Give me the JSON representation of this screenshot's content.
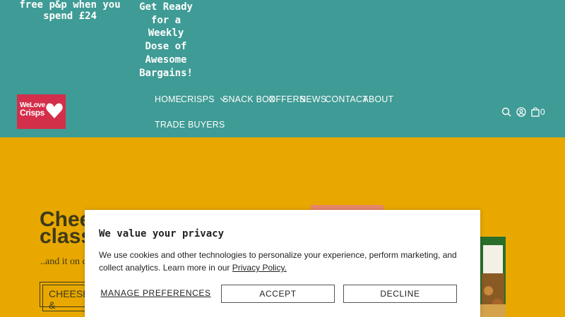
{
  "promo": {
    "delivery": "free p&p when you spend £24",
    "weekly": "Get Ready for a Weekly Dose of Awesome Bargains!"
  },
  "logo": {
    "line1": "WeLove",
    "line2": "Crisps"
  },
  "nav": {
    "home": "HOME",
    "crisps": "CRISPS",
    "snack_box": "SNACK BOX",
    "offers": "OFFERS",
    "news": "NEWS",
    "contact": "CONTACT",
    "about": "ABOUT",
    "trade_buyers": "TRADE BUYERS"
  },
  "header_icons": {
    "search": "search-icon",
    "account": "account-icon",
    "cart": "cart-icon",
    "cart_count": "0"
  },
  "hero": {
    "title_line1": "Chees",
    "title_line2": "classi",
    "subtitle": "..and it on c",
    "button": "CHEESE &"
  },
  "consent": {
    "title": "We value your privacy",
    "body": "We use cookies and other technologies to personalize your experience, perform marketing, and collect analytics. Learn more in our",
    "policy_link": "Privacy Policy.",
    "manage": "MANAGE PREFERENCES",
    "accept": "ACCEPT",
    "decline": "DECLINE"
  },
  "colors": {
    "header": "#3f9b95",
    "hero": "#e8a800",
    "logo": "#d42f4a"
  }
}
